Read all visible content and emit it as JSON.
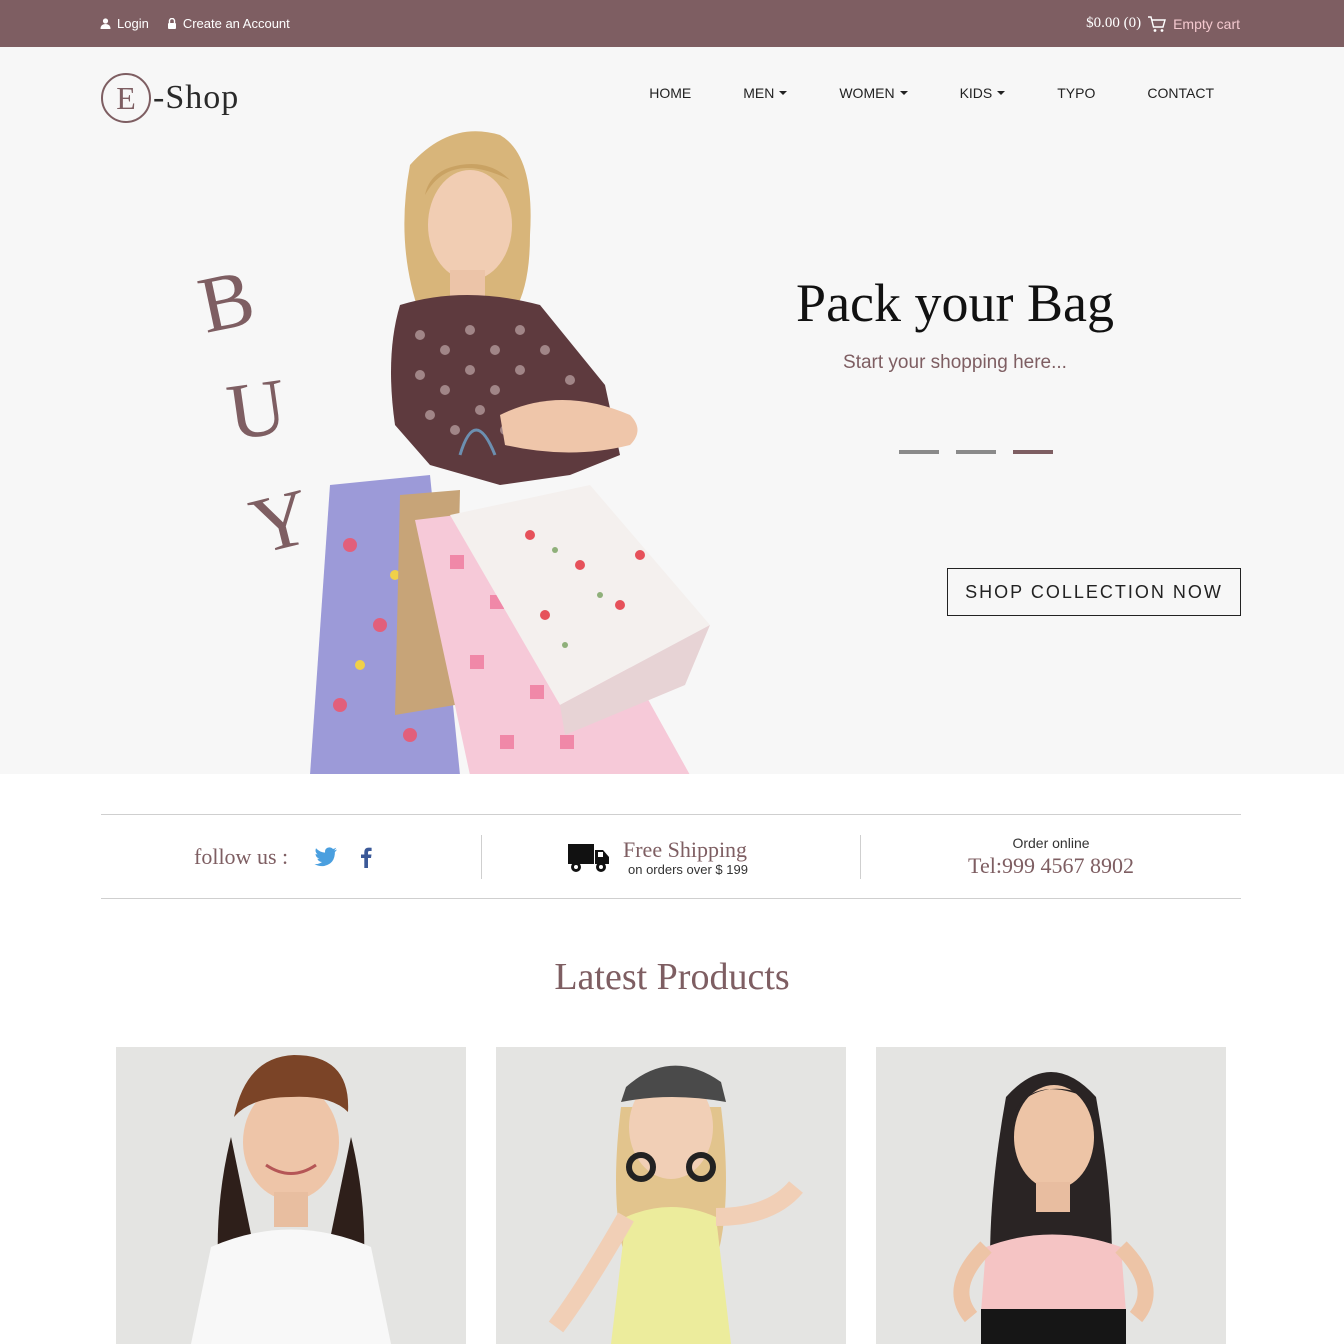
{
  "topbar": {
    "login": "Login",
    "create_account": "Create an Account",
    "cart_total": "$0.00 (0)",
    "cart_status": "Empty cart"
  },
  "logo": {
    "letter": "E",
    "rest": "-Shop"
  },
  "nav": {
    "items": [
      {
        "label": "HOME",
        "dropdown": false
      },
      {
        "label": "MEN",
        "dropdown": true
      },
      {
        "label": "WOMEN",
        "dropdown": true
      },
      {
        "label": "KIDS",
        "dropdown": true
      },
      {
        "label": "TYPO",
        "dropdown": false
      },
      {
        "label": "CONTACT",
        "dropdown": false
      }
    ]
  },
  "hero": {
    "buy_letters": [
      "B",
      "U",
      "Y"
    ],
    "title": "Pack your Bag",
    "subtitle": "Start your shopping here...",
    "slides": 3,
    "active_slide": 3,
    "cta": "SHOP COLLECTION NOW"
  },
  "info": {
    "follow_label": "follow us :",
    "social": [
      "twitter-icon",
      "facebook-icon"
    ],
    "shipping_title": "Free Shipping",
    "shipping_sub": "on orders over $ 199",
    "order_label": "Order online",
    "phone": "Tel:999 4567 8902"
  },
  "latest": {
    "title": "Latest Products"
  },
  "products": [
    {
      "image": "girl-brown-cap"
    },
    {
      "image": "girl-headphones-yellow-top"
    },
    {
      "image": "girl-pink-top"
    }
  ],
  "colors": {
    "brand": "#7e5e62",
    "hero_bg": "#f7f7f7",
    "card_bg": "#e4e4e2",
    "twitter": "#4a9fdf",
    "facebook": "#3b5998"
  }
}
